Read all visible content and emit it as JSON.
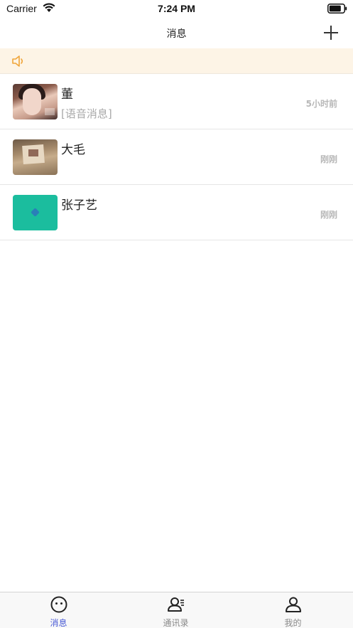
{
  "status_bar": {
    "carrier": "Carrier",
    "time": "7:24 PM"
  },
  "nav": {
    "title": "消息",
    "add_icon": "plus-icon"
  },
  "notice": {
    "icon": "speaker-icon",
    "icon_color": "#f0a53a",
    "background": "#fdf4e6"
  },
  "conversations": [
    {
      "name": "董",
      "preview": "[语音消息]",
      "time": "5小时前",
      "avatar": "photo-portrait"
    },
    {
      "name": "大毛",
      "preview": "",
      "time": "刚刚",
      "avatar": "photo-note"
    },
    {
      "name": "张子艺",
      "preview": "",
      "time": "刚刚",
      "avatar": "teal-placeholder"
    }
  ],
  "tabs": [
    {
      "label": "消息",
      "icon": "chat-face-icon",
      "active": true
    },
    {
      "label": "通讯录",
      "icon": "contacts-icon",
      "active": false
    },
    {
      "label": "我的",
      "icon": "person-icon",
      "active": false
    }
  ],
  "colors": {
    "accent": "#4a5bd6",
    "avatar_teal": "#1bbd9e"
  }
}
